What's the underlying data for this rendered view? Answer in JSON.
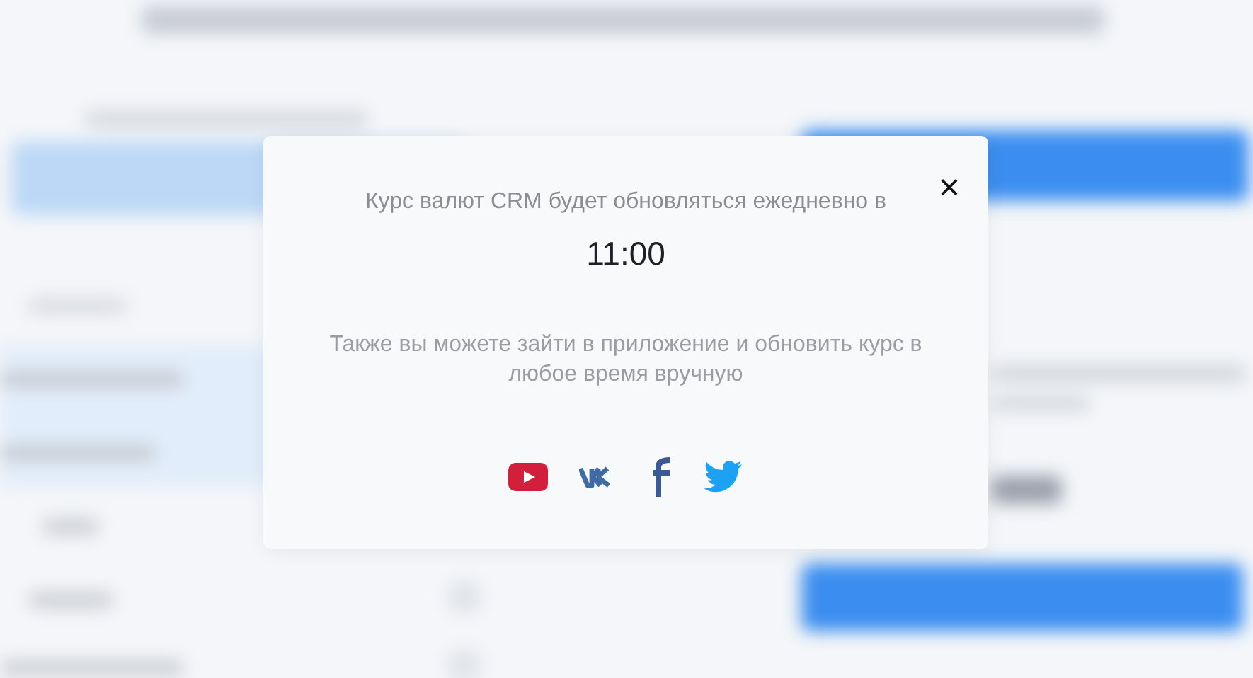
{
  "modal": {
    "close": "×",
    "message": "Курс валют CRM будет обновляться ежедневно в",
    "time": "11:00",
    "note": "Также вы можете зайти в приложение и обновить курс в любое время вручную",
    "social_links": [
      {
        "kind": "youtube"
      },
      {
        "kind": "vk"
      },
      {
        "kind": "facebook"
      },
      {
        "kind": "twitter"
      }
    ]
  }
}
